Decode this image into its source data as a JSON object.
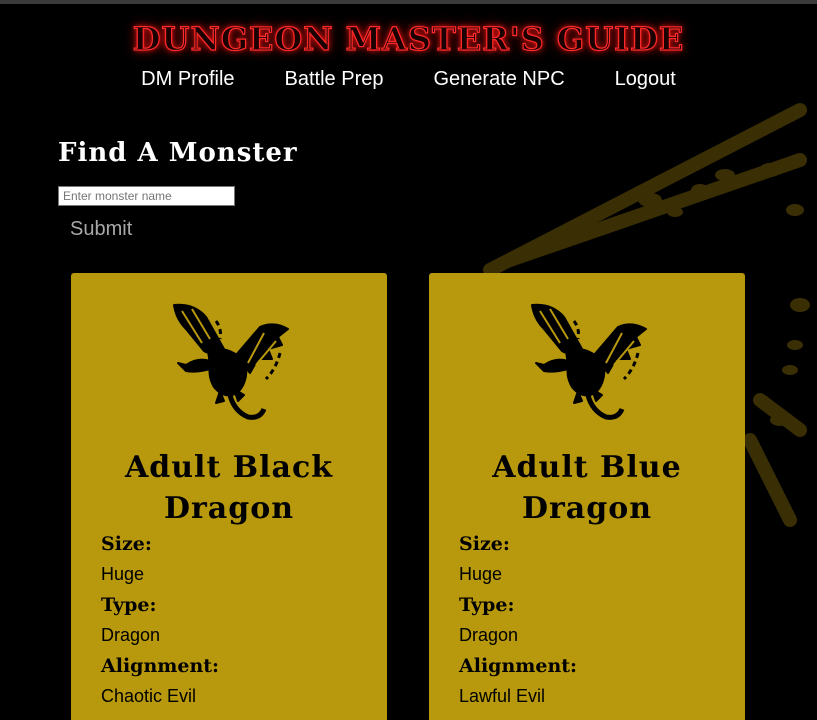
{
  "header": {
    "title": "DUNGEON MASTER'S GUIDE",
    "nav": [
      {
        "label": "DM Profile"
      },
      {
        "label": "Battle Prep"
      },
      {
        "label": "Generate NPC"
      },
      {
        "label": "Logout"
      }
    ]
  },
  "search": {
    "title": "Find A Monster",
    "placeholder": "Enter monster name",
    "submit_label": "Submit"
  },
  "monsters": [
    {
      "name": "Adult Black Dragon",
      "size_label": "Size:",
      "size": "Huge",
      "type_label": "Type:",
      "type": "Dragon",
      "alignment_label": "Alignment:",
      "alignment": "Chaotic Evil",
      "icon": "dragon-icon"
    },
    {
      "name": "Adult Blue Dragon",
      "size_label": "Size:",
      "size": "Huge",
      "type_label": "Type:",
      "type": "Dragon",
      "alignment_label": "Alignment:",
      "alignment": "Lawful Evil",
      "icon": "dragon-icon"
    }
  ],
  "colors": {
    "background": "#000000",
    "card": "#b8990d",
    "title_glow": "#ff2a2a",
    "background_art": "#3a2e05"
  }
}
